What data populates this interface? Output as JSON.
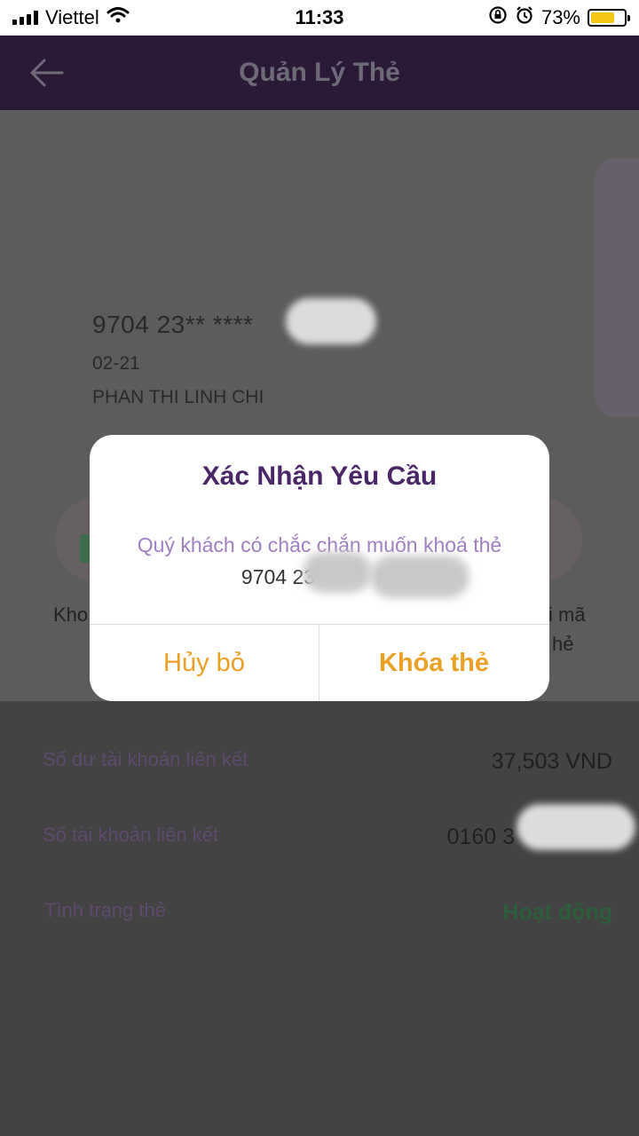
{
  "status_bar": {
    "carrier": "Viettel",
    "time": "11:33",
    "battery_percent": "73%",
    "battery_level": 0.73,
    "icons": [
      "signal-icon",
      "wifi-icon",
      "orientation-lock-icon",
      "alarm-icon",
      "battery-icon"
    ]
  },
  "header": {
    "title": "Quản Lý Thẻ",
    "back_icon": "arrow-left-icon"
  },
  "card": {
    "number": "9704 23** ****",
    "expiry": "02-21",
    "holder": "PHAN THI LINH CHI"
  },
  "actions": {
    "left_label": "Kho",
    "right_label_1": "i mã",
    "right_label_2": "hẻ"
  },
  "info": {
    "balance_label": "Số dư tài khoản liên kết",
    "balance_value": "37,503 VND",
    "account_label": "Số tài khoản liên kết",
    "account_value": "0160 3",
    "status_label": "Tình trạng thẻ",
    "status_value": "Hoạt động"
  },
  "modal": {
    "title": "Xác Nhận Yêu Cầu",
    "message": "Quý khách có chắc chắn muốn khoá thẻ",
    "card_ref": "9704 23",
    "card_ref_tail": "xx",
    "cancel_label": "Hủy bỏ",
    "confirm_label": "Khóa thẻ"
  },
  "colors": {
    "header_bg": "#2b1a36",
    "modal_title": "#4a2668",
    "modal_message": "#a07fc1",
    "button_accent": "#eba024",
    "status_active": "#2d5e3c"
  }
}
